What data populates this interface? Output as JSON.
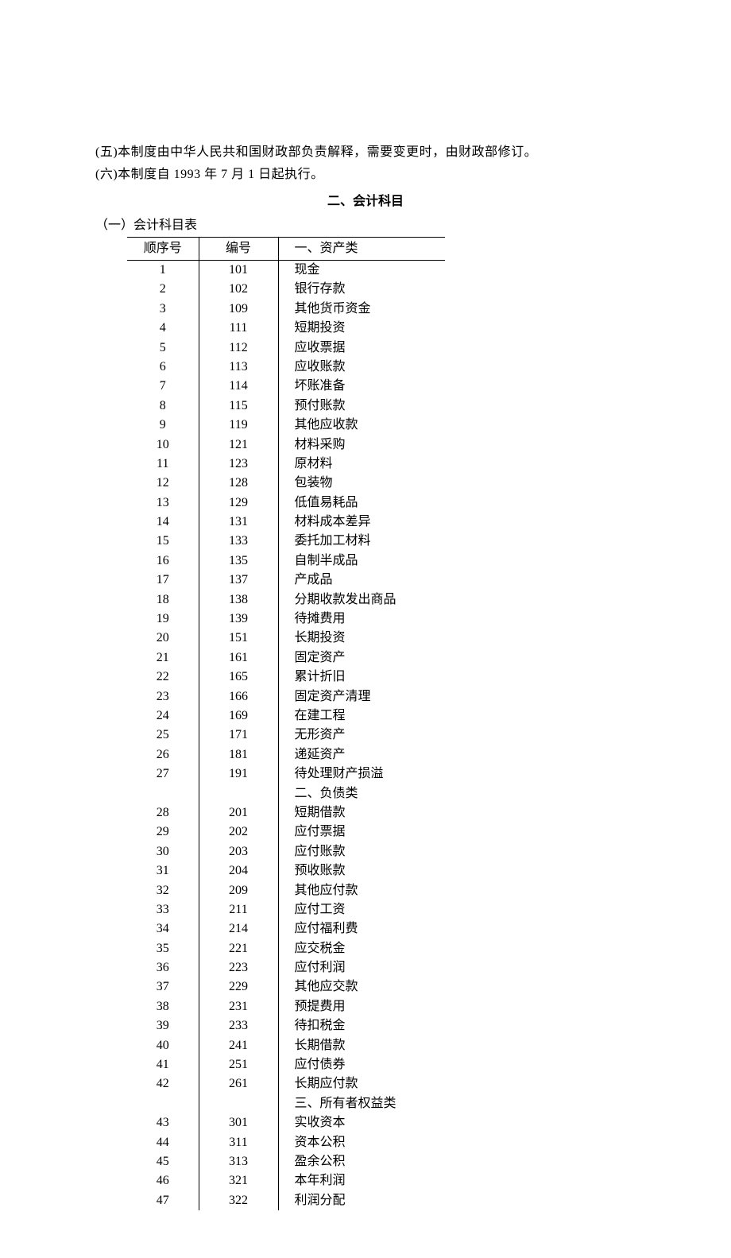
{
  "paragraphs": {
    "p5": "(五)本制度由中华人民共和国财政部负责解释，需要变更时，由财政部修订。",
    "p6": "(六)本制度自 1993 年 7 月 1 日起执行。"
  },
  "section_title": "二、会计科目",
  "subsection_title": "（一）会计科目表",
  "headers": {
    "seq": "顺序号",
    "code": "编号",
    "name": "一、资产类"
  },
  "rows": [
    {
      "seq": "1",
      "code": "101",
      "name": "现金"
    },
    {
      "seq": "2",
      "code": "102",
      "name": "银行存款"
    },
    {
      "seq": "3",
      "code": "109",
      "name": "其他货币资金"
    },
    {
      "seq": "4",
      "code": "111",
      "name": "短期投资"
    },
    {
      "seq": "5",
      "code": "112",
      "name": "应收票据"
    },
    {
      "seq": "6",
      "code": "113",
      "name": "应收账款"
    },
    {
      "seq": "7",
      "code": "114",
      "name": "坏账准备"
    },
    {
      "seq": "8",
      "code": "115",
      "name": "预付账款"
    },
    {
      "seq": "9",
      "code": "119",
      "name": "其他应收款"
    },
    {
      "seq": "10",
      "code": "121",
      "name": "材料采购"
    },
    {
      "seq": "11",
      "code": "123",
      "name": "原材料"
    },
    {
      "seq": "12",
      "code": "128",
      "name": "包装物"
    },
    {
      "seq": "13",
      "code": "129",
      "name": "低值易耗品"
    },
    {
      "seq": "14",
      "code": "131",
      "name": "材料成本差异"
    },
    {
      "seq": "15",
      "code": "133",
      "name": "委托加工材料"
    },
    {
      "seq": "16",
      "code": "135",
      "name": "自制半成品"
    },
    {
      "seq": "17",
      "code": "137",
      "name": "产成品"
    },
    {
      "seq": "18",
      "code": "138",
      "name": "分期收款发出商品"
    },
    {
      "seq": "19",
      "code": "139",
      "name": "待摊费用"
    },
    {
      "seq": "20",
      "code": "151",
      "name": "长期投资"
    },
    {
      "seq": "21",
      "code": "161",
      "name": "固定资产"
    },
    {
      "seq": "22",
      "code": "165",
      "name": "累计折旧"
    },
    {
      "seq": "23",
      "code": "166",
      "name": "固定资产清理"
    },
    {
      "seq": "24",
      "code": "169",
      "name": "在建工程"
    },
    {
      "seq": "25",
      "code": "171",
      "name": "无形资产"
    },
    {
      "seq": "26",
      "code": "181",
      "name": "递延资产"
    },
    {
      "seq": "27",
      "code": "191",
      "name": "待处理财产损溢"
    },
    {
      "seq": "",
      "code": "",
      "name": "二、负债类"
    },
    {
      "seq": "28",
      "code": "201",
      "name": "短期借款"
    },
    {
      "seq": "29",
      "code": "202",
      "name": "应付票据"
    },
    {
      "seq": "30",
      "code": "203",
      "name": "应付账款"
    },
    {
      "seq": "31",
      "code": "204",
      "name": "预收账款"
    },
    {
      "seq": "32",
      "code": "209",
      "name": "其他应付款"
    },
    {
      "seq": "33",
      "code": "211",
      "name": "应付工资"
    },
    {
      "seq": "34",
      "code": "214",
      "name": "应付福利费"
    },
    {
      "seq": "35",
      "code": "221",
      "name": "应交税金"
    },
    {
      "seq": "36",
      "code": "223",
      "name": "应付利润"
    },
    {
      "seq": "37",
      "code": "229",
      "name": "其他应交款"
    },
    {
      "seq": "38",
      "code": "231",
      "name": "预提费用"
    },
    {
      "seq": "39",
      "code": "233",
      "name": "待扣税金"
    },
    {
      "seq": "40",
      "code": "241",
      "name": "长期借款"
    },
    {
      "seq": "41",
      "code": "251",
      "name": "应付债券"
    },
    {
      "seq": "42",
      "code": "261",
      "name": "长期应付款"
    },
    {
      "seq": "",
      "code": "",
      "name": "三、所有者权益类"
    },
    {
      "seq": "43",
      "code": "301",
      "name": "实收资本"
    },
    {
      "seq": "44",
      "code": "311",
      "name": "资本公积"
    },
    {
      "seq": "45",
      "code": "313",
      "name": "盈余公积"
    },
    {
      "seq": "46",
      "code": "321",
      "name": "本年利润"
    },
    {
      "seq": "47",
      "code": "322",
      "name": "利润分配"
    }
  ]
}
